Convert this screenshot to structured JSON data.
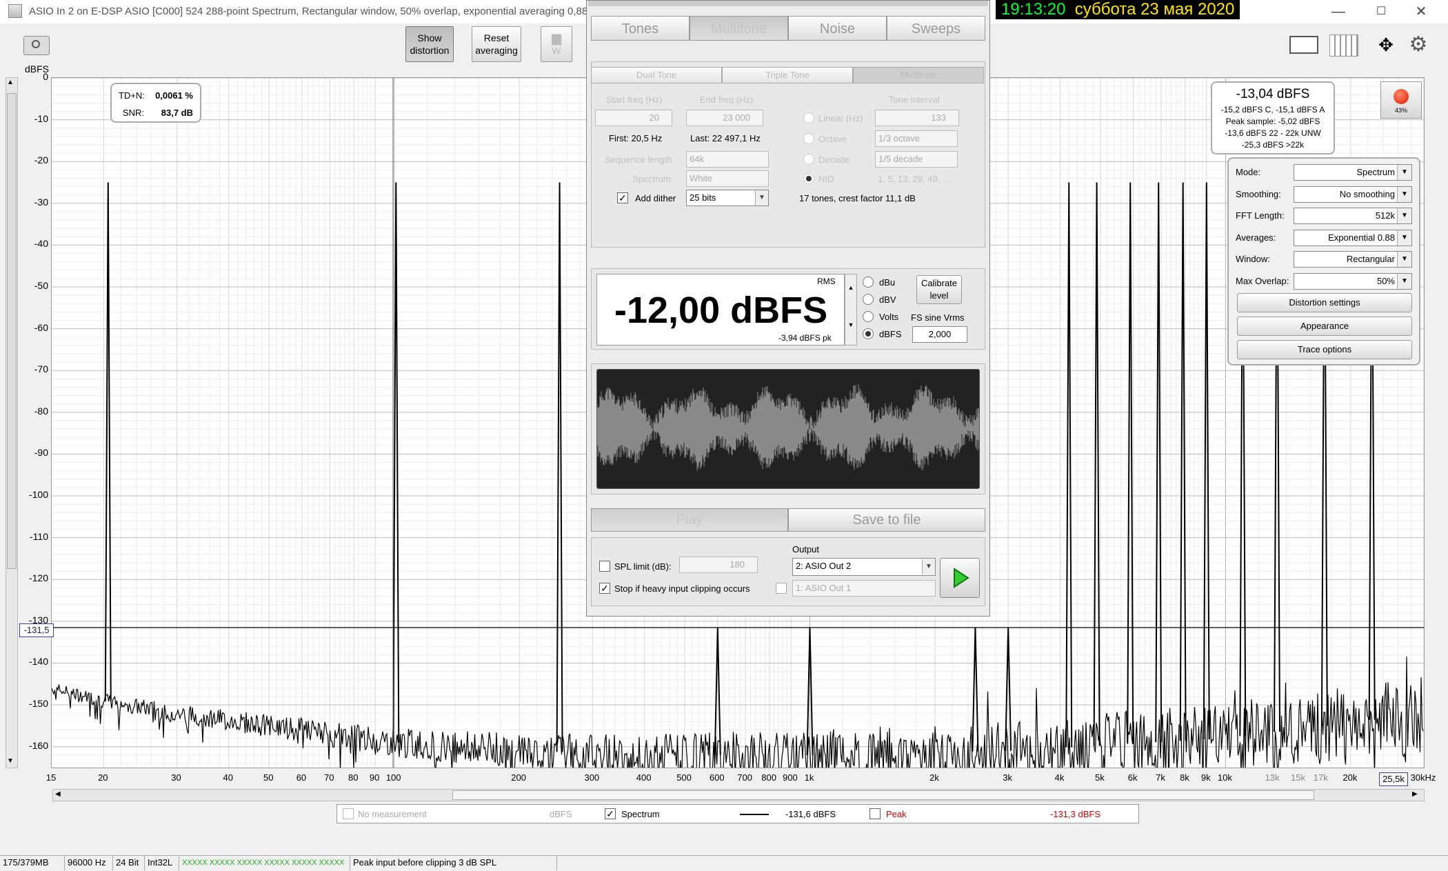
{
  "window": {
    "title": "ASIO In 2 on E-DSP ASIO [C000] 524 288-point Spectrum, Rectangular window, 50% overlap, exponential averaging 0,88",
    "clock_time": "19:13:20",
    "clock_date": "суббота 23 мая 2020",
    "minimize": "—",
    "maximize": "☐",
    "close": "✕"
  },
  "toolbar": {
    "show_distortion": "Show distortion",
    "reset_averaging": "Reset averaging",
    "w_label": "W"
  },
  "plot": {
    "y_unit": "dBFS",
    "y_ticks": [
      "0",
      "-10",
      "-20",
      "-30",
      "-40",
      "-50",
      "-60",
      "-70",
      "-80",
      "-90",
      "-100",
      "-110",
      "-120",
      "-130",
      "-140",
      "-150",
      "-160"
    ],
    "cursor_value": "-131,5",
    "x_ticks": [
      {
        "f": 15,
        "t": "15"
      },
      {
        "f": 20,
        "t": "20"
      },
      {
        "f": 30,
        "t": "30"
      },
      {
        "f": 40,
        "t": "40"
      },
      {
        "f": 50,
        "t": "50"
      },
      {
        "f": 60,
        "t": "60"
      },
      {
        "f": 70,
        "t": "70"
      },
      {
        "f": 80,
        "t": "80"
      },
      {
        "f": 90,
        "t": "90"
      },
      {
        "f": 100,
        "t": "100"
      },
      {
        "f": 200,
        "t": "200"
      },
      {
        "f": 300,
        "t": "300"
      },
      {
        "f": 400,
        "t": "400"
      },
      {
        "f": 500,
        "t": "500"
      },
      {
        "f": 600,
        "t": "600"
      },
      {
        "f": 700,
        "t": "700"
      },
      {
        "f": 800,
        "t": "800"
      },
      {
        "f": 900,
        "t": "900"
      },
      {
        "f": 1000,
        "t": "1k"
      },
      {
        "f": 2000,
        "t": "2k"
      },
      {
        "f": 3000,
        "t": "3k"
      },
      {
        "f": 4000,
        "t": "4k"
      },
      {
        "f": 5000,
        "t": "5k"
      },
      {
        "f": 6000,
        "t": "6k"
      },
      {
        "f": 7000,
        "t": "7k"
      },
      {
        "f": 8000,
        "t": "8k"
      },
      {
        "f": 9000,
        "t": "9k"
      },
      {
        "f": 10000,
        "t": "10k"
      },
      {
        "f": 13000,
        "t": "13k",
        "dim": true
      },
      {
        "f": 15000,
        "t": "15k",
        "dim": true
      },
      {
        "f": 17000,
        "t": "17k",
        "dim": true
      },
      {
        "f": 20000,
        "t": "20k"
      },
      {
        "f": 30000,
        "t": "30kHz"
      }
    ],
    "cursor_freq": "25,5k",
    "tdn_label": "TD+N:",
    "tdn_value": "0,0061 %",
    "snr_label": "SNR:",
    "snr_value": "83,7 dB"
  },
  "chart_data": {
    "type": "line",
    "xlabel": "",
    "ylabel": "dBFS",
    "xscale": "log",
    "xlim": [
      15,
      30000
    ],
    "ylim": [
      -165,
      0
    ],
    "grid": true,
    "series": [
      {
        "name": "Spectrum",
        "tones_hz": [
          20.5,
          101,
          250,
          600,
          1000,
          2500,
          3000,
          4200,
          4900,
          5900,
          6900,
          7900,
          9000,
          11000,
          13300,
          17300,
          22500
        ],
        "tone_peak_dbfs": [
          -25,
          -25,
          -25,
          -131.5,
          -131.5,
          -131.5,
          -131.5,
          -25,
          -25,
          -25,
          -25,
          -25,
          -25,
          -25,
          -25,
          -25,
          -25
        ],
        "noise_floor_points": [
          [
            15,
            -146
          ],
          [
            20,
            -149
          ],
          [
            30,
            -152
          ],
          [
            50,
            -155
          ],
          [
            100,
            -159
          ],
          [
            200,
            -161
          ],
          [
            500,
            -162
          ],
          [
            1000,
            -162
          ],
          [
            3000,
            -161
          ],
          [
            10000,
            -158
          ],
          [
            30000,
            -152
          ]
        ]
      }
    ]
  },
  "level_box": {
    "main": "-13,04 dBFS",
    "line1": "-15,2 dBFS C, -15,1 dBFS A",
    "line2": "Peak sample: -5,02 dBFS",
    "line3": "-13,6 dBFS 22 - 22k UNW",
    "line4": "-25,3 dBFS >22k",
    "rec_pct": "43%"
  },
  "controls": [
    {
      "label": "Mode:",
      "value": "Spectrum"
    },
    {
      "label": "Smoothing:",
      "value": "No  smoothing"
    },
    {
      "label": "FFT Length:",
      "value": "512k"
    },
    {
      "label": "Averages:",
      "value": "Exponential 0.88"
    },
    {
      "label": "Window:",
      "value": "Rectangular"
    },
    {
      "label": "Max Overlap:",
      "value": "50%"
    }
  ],
  "panel_buttons": [
    "Distortion settings",
    "Appearance",
    "Trace options"
  ],
  "generator": {
    "tabs": [
      "Tones",
      "Multitone",
      "Noise",
      "Sweeps"
    ],
    "subtabs": [
      "Dual Tone",
      "Triple Tone",
      "Multitone"
    ],
    "start_freq_label": "Start freq (Hz)",
    "start_freq_value": "20",
    "end_freq_label": "End freq (Hz)",
    "end_freq_value": "23 000",
    "tone_interval_label": "Tone interval",
    "tone_interval_value": "133",
    "first": "First: 20,5 Hz",
    "last": "Last: 22 497,1 Hz",
    "linear": "Linear (Hz)",
    "octave": "Octave",
    "octave_value": "1/3 octave",
    "decade": "Decade",
    "decade_value": "1/5 decade",
    "nid": "NID",
    "nid_value": "1, 5, 13, 29, 49, ...",
    "seq_len_label": "Sequence length",
    "seq_len_value": "64k",
    "spectrum_label": "Spectrum",
    "spectrum_value": "White",
    "add_dither": "Add dither",
    "dither_bits": "25 bits",
    "tones_info": "17 tones, crest factor 11,1 dB",
    "rms": "RMS",
    "level": "-12,00 dBFS",
    "level_pk": "-3,94 dBFS pk",
    "units": [
      "dBu",
      "dBV",
      "Volts",
      "dBFS"
    ],
    "calibrate": "Calibrate level",
    "fs_sine": "FS sine Vrms",
    "fs_value": "2,000",
    "play": "Play",
    "save": "Save to file",
    "spl_limit": "SPL limit (dB):",
    "spl_value": "180",
    "stop_clip": "Stop if heavy input clipping occurs",
    "output_label": "Output",
    "output_value": "2: ASIO Out 2",
    "output2_value": "1: ASIO Out 1"
  },
  "legend": {
    "no_measurement": "No measurement",
    "no_meas_unit": "dBFS",
    "spectrum": "Spectrum",
    "spectrum_value": "-131,6 dBFS",
    "peak": "Peak",
    "peak_value": "-131,3 dBFS",
    "peak_color": "#cc0000"
  },
  "status": [
    "175/379MB",
    "96000 Hz",
    "24 Bit",
    "Int32L",
    "XXXXX XXXXX  XXXXX XXXXX  XXXXX XXXXX",
    "Peak input before clipping 3 dB SPL"
  ]
}
